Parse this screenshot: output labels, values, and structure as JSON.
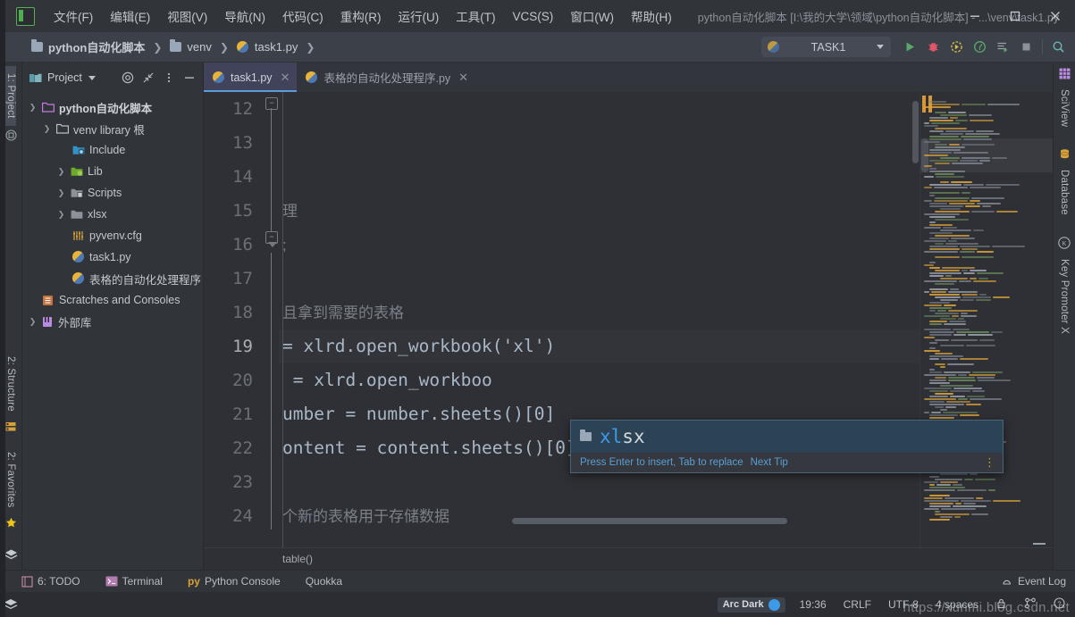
{
  "window": {
    "title": "python自动化脚本 [I:\\我的大学\\领域\\python自动化脚本] - ...\\venv\\task1.py",
    "logo": "PC",
    "minimize": "—",
    "maximize": "▢",
    "close": "✕"
  },
  "menu": [
    {
      "label": "文件(F)",
      "name": "menu-file"
    },
    {
      "label": "编辑(E)",
      "name": "menu-edit"
    },
    {
      "label": "视图(V)",
      "name": "menu-view"
    },
    {
      "label": "导航(N)",
      "name": "menu-navigate"
    },
    {
      "label": "代码(C)",
      "name": "menu-code"
    },
    {
      "label": "重构(R)",
      "name": "menu-refactor"
    },
    {
      "label": "运行(U)",
      "name": "menu-run"
    },
    {
      "label": "工具(T)",
      "name": "menu-tools"
    },
    {
      "label": "VCS(S)",
      "name": "menu-vcs"
    },
    {
      "label": "窗口(W)",
      "name": "menu-window"
    },
    {
      "label": "帮助(H)",
      "name": "menu-help"
    }
  ],
  "breadcrumbs": [
    {
      "label": "python自动化脚本",
      "icon": "folder-icon",
      "bold": true
    },
    {
      "label": "venv",
      "icon": "folder-icon",
      "bold": false
    },
    {
      "label": "task1.py",
      "icon": "python-file-icon",
      "bold": false
    }
  ],
  "toolbar": {
    "run_config": "TASK1",
    "run_config_icon": "python-icon",
    "buttons": [
      {
        "name": "run-button",
        "glyph": "▶",
        "color": "#5ba85b"
      },
      {
        "name": "debug-button",
        "glyph": "🐞",
        "color": "#e05263"
      },
      {
        "name": "run-coverage-button",
        "glyph": "◉",
        "color": "#d8c14a"
      },
      {
        "name": "profile-button",
        "glyph": "◎",
        "color": "#5ba85b"
      },
      {
        "name": "run-console-button",
        "glyph": "≡▶",
        "color": "#5ba85b"
      },
      {
        "name": "stop-button",
        "glyph": "■",
        "color": "#8d9199"
      },
      {
        "name": "search-everywhere-icon",
        "glyph": "🔍",
        "color": "#69b0b0"
      }
    ]
  },
  "sidebar_left": {
    "top": [
      {
        "label": "1: Project",
        "name": "tool-window-project",
        "selected": true
      }
    ],
    "bottom": [
      {
        "label": "2: Structure",
        "name": "tool-window-structure"
      },
      {
        "label": "2: Favorites",
        "name": "tool-window-favorites"
      }
    ]
  },
  "sidebar_right": [
    {
      "label": "SciView",
      "name": "tool-window-sciview"
    },
    {
      "label": "Database",
      "name": "tool-window-database"
    },
    {
      "label": "Key Promoter X",
      "name": "tool-window-key-promoter-x"
    }
  ],
  "project_panel": {
    "title": "Project",
    "header_buttons": [
      "target-icon",
      "collapse-all-icon",
      "options-icon",
      "hide-icon"
    ],
    "tree": [
      {
        "label": "python自动化脚本",
        "arrow": "▾",
        "depth": 0,
        "icon": "folder-project",
        "bold": true
      },
      {
        "label": "venv library 根",
        "arrow": "▾",
        "depth": 1,
        "icon": "folder-plain",
        "bold": false
      },
      {
        "label": "Include",
        "arrow": "",
        "depth": 2,
        "icon": "folder-include",
        "bold": false
      },
      {
        "label": "Lib",
        "arrow": "›",
        "depth": 2,
        "icon": "folder-lib",
        "bold": false
      },
      {
        "label": "Scripts",
        "arrow": "›",
        "depth": 2,
        "icon": "folder-scripts",
        "bold": false
      },
      {
        "label": "xlsx",
        "arrow": "›",
        "depth": 2,
        "icon": "folder-plain",
        "bold": false
      },
      {
        "label": "pyvenv.cfg",
        "arrow": "",
        "depth": 2,
        "icon": "config-file",
        "bold": false
      },
      {
        "label": "task1.py",
        "arrow": "",
        "depth": 2,
        "icon": "python-file",
        "bold": false
      },
      {
        "label": "表格的自动化处理程序",
        "arrow": "",
        "depth": 2,
        "icon": "python-file",
        "bold": false
      },
      {
        "label": "Scratches and Consoles",
        "arrow": "",
        "depth": 0,
        "icon": "scratches",
        "bold": false
      },
      {
        "label": "外部库",
        "arrow": "›",
        "depth": 0,
        "icon": "external-libs",
        "bold": false
      }
    ]
  },
  "editor": {
    "tabs": [
      {
        "label": "task1.py",
        "active": true,
        "icon": "python-file",
        "close": "✕"
      },
      {
        "label": "表格的自动化处理程序.py",
        "active": false,
        "icon": "python-file",
        "close": "✕"
      }
    ],
    "lines": [
      {
        "num": "12",
        "text": "",
        "current": false
      },
      {
        "num": "13",
        "text": "",
        "current": false
      },
      {
        "num": "14",
        "text": "",
        "current": false
      },
      {
        "num": "15",
        "text": "理",
        "current": false,
        "style": "comment"
      },
      {
        "num": "16",
        "text": ";",
        "current": false,
        "style": "comment"
      },
      {
        "num": "17",
        "text": "",
        "current": false
      },
      {
        "num": "18",
        "text": "且拿到需要的表格",
        "current": false,
        "style": "comment"
      },
      {
        "num": "19",
        "text": "= xlrd.open_workbook('xl')",
        "current": true,
        "style": "code"
      },
      {
        "num": "20",
        "text": " = xlrd.open_workboo",
        "current": false,
        "style": "code"
      },
      {
        "num": "21",
        "text": "umber = number.sheets()[0]",
        "current": false,
        "style": "code"
      },
      {
        "num": "22",
        "text": "ontent = content.sheets()[0]",
        "current": false,
        "style": "code"
      },
      {
        "num": "23",
        "text": "",
        "current": false
      },
      {
        "num": "24",
        "text": "个新的表格用于存储数据",
        "current": false,
        "style": "comment"
      }
    ],
    "breadcrumb": "table()"
  },
  "autocomplete": {
    "item_prefix": "xl",
    "item_suffix": "sx",
    "item_icon": "folder-icon",
    "hint": "Press Enter to insert, Tab to replace",
    "hint_next": "Next Tip",
    "more_icon": "more-options-icon"
  },
  "tool_windows": [
    {
      "label": "6: TODO",
      "name": "tool-window-todo",
      "icon": "todo-icon"
    },
    {
      "label": "Terminal",
      "name": "tool-window-terminal",
      "icon": "terminal-icon"
    },
    {
      "label": "Python Console",
      "name": "tool-window-python-console",
      "icon": "py-icon"
    },
    {
      "label": "Quokka",
      "name": "tool-window-quokka",
      "icon": ""
    }
  ],
  "event_log": {
    "label": "Event Log",
    "icon": "bell-icon"
  },
  "status_bar": {
    "theme": "Arc Dark",
    "time": "19:36",
    "line_separator": "CRLF",
    "encoding": "UTF-8",
    "indent": "4 spaces",
    "icons": [
      "lock-icon",
      "branch-icon",
      "help-icon"
    ]
  },
  "watermark": "https://xunmi.blog.csdn.net",
  "colors": {
    "accent_blue": "#3c9ae8",
    "tab_active": "#41435a",
    "bg_panel": "#313439",
    "bg_editor": "#2e3035",
    "string_green": "#6A8759",
    "comment_gray": "#7a7f88"
  }
}
